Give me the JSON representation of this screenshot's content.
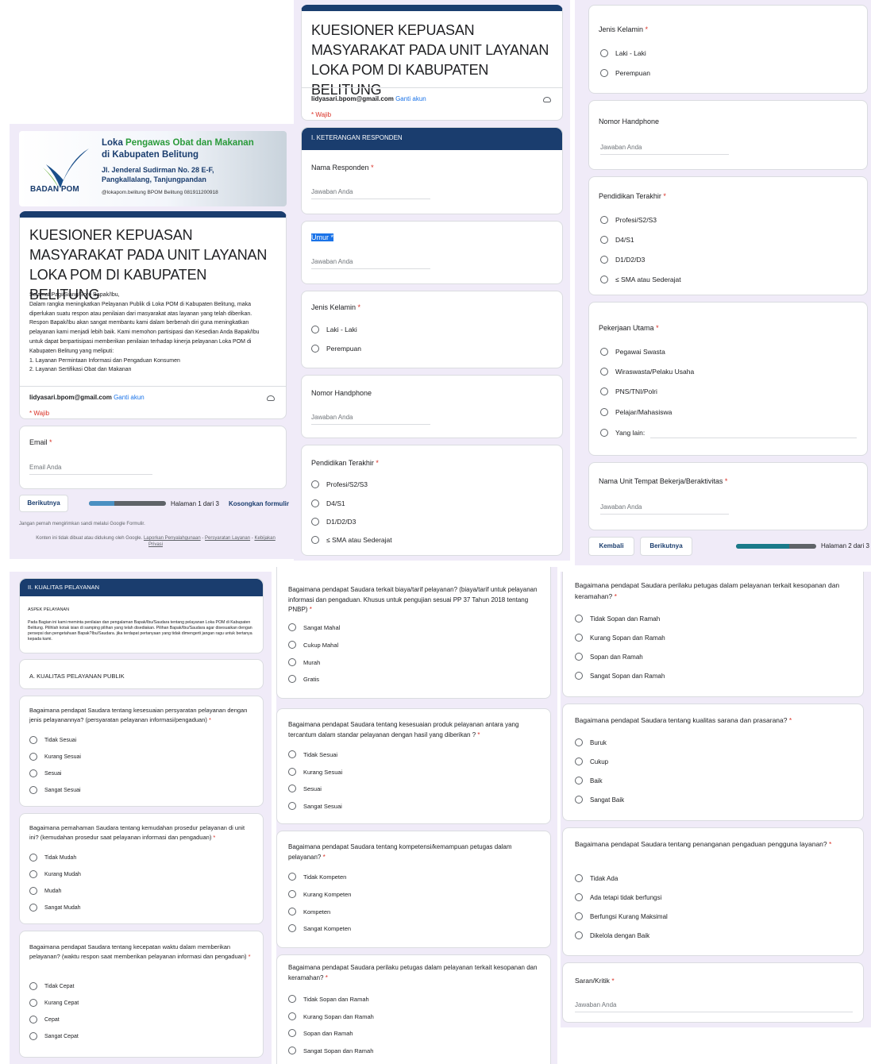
{
  "form": {
    "title": "KUESIONER KEPUASAN MASYARAKAT PADA UNIT LAYANAN LOKA POM DI KABUPATEN BELITUNG",
    "account": "lidyasari.bpom@gmail.com",
    "switch_account": "Ganti akun",
    "required_note": "* Wajib",
    "description": [
      "Selamat Pagi/Siang/Sore Bapak/Ibu,",
      "Dalam rangka meningkatkan Pelayanan Publik di Loka POM di Kabupaten Belitung, maka diperlukan suatu respon atau penilaian dari masyarakat atas layanan yang telah diberikan. Respon Bapak/Ibu akan sangat membantu kami dalam berbenah diri guna meningkatkan pelayanan kami menjadi lebih baik. Kami memohon partisipasi dan Kesedian Anda Bapak/Ibu untuk dapat berpartisipasi memberikan penilaian terhadap kinerja pelayanan Loka POM di Kabupaten Belitung yang meliputi:",
      "1. Layanan Permintaan Informasi dan Pengaduan Konsumen",
      "2. Layanan Sertifikasi Obat dan Makanan"
    ],
    "answer_placeholder": "Jawaban Anda",
    "asterisk": "*"
  },
  "banner": {
    "line1a": "Loka ",
    "line1b": "Pengawas Obat dan Makanan",
    "line2": "di Kabupaten Belitung",
    "addr1": "Jl. Jenderal Sudirman No. 28 E-F,",
    "addr2": "Pangkallalang, Tanjungpandan",
    "social": "@lokapom.belitung  BPOM Belitung  081911200918",
    "logo_text": "BADAN POM"
  },
  "panel1": {
    "email_label": "Email",
    "email_placeholder": "Email Anda",
    "next": "Berikutnya",
    "page": "Halaman 1 dari 3",
    "clear": "Kosongkan formulir",
    "progress": 0.33,
    "footer1": "Jangan pernah mengirimkan sandi melalui Google Formulir.",
    "footer2a": "Konten ini tidak dibuat atau didukung oleh Google. ",
    "footer2b": "Laporkan Penyalahgunaan",
    "footer2c": " - ",
    "footer2d": "Persyaratan Layanan",
    "footer2e": " - ",
    "footer2f": "Kebijakan Privasi"
  },
  "panel2": {
    "section": "I. KETERANGAN RESPONDEN",
    "name": "Nama Responden",
    "age": "Umur",
    "gender": "Jenis Kelamin",
    "gender_opts": [
      "Laki - Laki",
      "Perempuan"
    ],
    "phone": "Nomor Handphone",
    "edu": "Pendidikan Terakhir",
    "edu_opts": [
      "Profesi/S2/S3",
      "D4/S1",
      "D1/D2/D3",
      "≤ SMA atau Sederajat"
    ]
  },
  "panel3": {
    "gender": "Jenis Kelamin",
    "gender_opts": [
      "Laki - Laki",
      "Perempuan"
    ],
    "phone": "Nomor Handphone",
    "edu": "Pendidikan Terakhir",
    "edu_opts": [
      "Profesi/S2/S3",
      "D4/S1",
      "D1/D2/D3",
      "≤ SMA atau Sederajat"
    ],
    "job": "Pekerjaan Utama",
    "job_opts": [
      "Pegawai Swasta",
      "Wiraswasta/Pelaku Usaha",
      "PNS/TNI/Polri",
      "Pelajar/Mahasiswa",
      "Yang lain:"
    ],
    "unit": "Nama Unit Tempat Bekerja/Beraktivitas",
    "back": "Kembali",
    "next": "Berikutnya",
    "page": "Halaman 2 dari 3",
    "progress": 0.66
  },
  "panel4": {
    "section": "II. KUALITAS PELAYANAN",
    "aspect_title": "ASPEK PELAYANAN",
    "aspect_desc": "Pada Bagian ini kami meminta penilaian dan pengalaman Bapak/Ibu/Saudara tentang pelayanan Loka POM di Kabupaten Belitung. Pilihlah kotak isian di samping pilihan yang telah disediakan. Pilihan Bapak/Ibu/Saudara agar disesuaikan dengan persepsi dan pengetahuan Bapak?Ibu/Saudara. jika terdapat pertanyaan yang tidak dimengerti jangan ragu untuk bertanya kepada kami.",
    "subsection": "A. KUALITAS PELAYANAN PUBLIK",
    "q1": "Bagaimana pendapat Saudara tentang kesesuaian persyaratan pelayanan dengan jenis pelayanannya? (persyaratan pelayanan informasi/pengaduan)",
    "q1_opts": [
      "Tidak Sesuai",
      "Kurang Sesuai",
      "Sesuai",
      "Sangat Sesuai"
    ],
    "q2": "Bagaimana pemahaman Saudara tentang kemudahan prosedur pelayanan di unit ini? (kemudahan prosedur saat pelayanan informasi dan pengaduan)",
    "q2_opts": [
      "Tidak Mudah",
      "Kurang Mudah",
      "Mudah",
      "Sangat Mudah"
    ],
    "q3": "Bagaimana pendapat Saudara tentang kecepatan waktu dalam memberikan pelayanan? (waktu respon saat memberikan pelayanan informasi dan pengaduan)",
    "q3_opts": [
      "Tidak Cepat",
      "Kurang Cepat",
      "Cepat",
      "Sangat Cepat"
    ]
  },
  "panel5": {
    "q1": "Bagaimana pendapat Saudara terkait biaya/tarif pelayanan? (biaya/tarif untuk pelayanan informasi dan pengaduan. Khusus untuk pengujian sesuai PP 37 Tahun 2018 tentang PNBP)",
    "q1_opts": [
      "Sangat Mahal",
      "Cukup Mahal",
      "Murah",
      "Gratis"
    ],
    "q2": "Bagaimana pendapat Saudara tentang kesesuaian produk pelayanan antara yang tercantum dalam standar pelayanan dengan hasil yang diberikan ?",
    "q2_opts": [
      "Tidak Sesuai",
      "Kurang Sesuai",
      "Sesuai",
      "Sangat Sesuai"
    ],
    "q3": "Bagaimana pendapat Saudara tentang kompetensi/kemampuan petugas dalam pelayanan?",
    "q3_opts": [
      "Tidak Kompeten",
      "Kurang Kompeten",
      "Kompeten",
      "Sangat Kompeten"
    ],
    "q4": "Bagaimana pendapat Saudara perilaku petugas dalam pelayanan terkait kesopanan dan keramahan?",
    "q4_opts": [
      "Tidak Sopan dan Ramah",
      "Kurang Sopan dan Ramah",
      "Sopan dan Ramah",
      "Sangat Sopan dan Ramah"
    ]
  },
  "panel6": {
    "q1": "Bagaimana pendapat Saudara perilaku petugas dalam pelayanan terkait kesopanan dan keramahan?",
    "q1_opts": [
      "Tidak Sopan dan Ramah",
      "Kurang Sopan dan Ramah",
      "Sopan dan Ramah",
      "Sangat Sopan dan Ramah"
    ],
    "q2": "Bagaimana pendapat Saudara tentang kualitas sarana dan prasarana?",
    "q2_opts": [
      "Buruk",
      "Cukup",
      "Baik",
      "Sangat Baik"
    ],
    "q3": "Bagaimana pendapat Saudara tentang penanganan pengaduan pengguna layanan?",
    "q3_opts": [
      "Tidak Ada",
      "Ada tetapi tidak berfungsi",
      "Berfungsi Kurang Maksimal",
      "Dikelola dengan Baik"
    ],
    "q4": "Saran/Kritik"
  },
  "colors": {
    "header": "#1a3d6e",
    "background": "#f0ebf8",
    "required": "#d93025",
    "link": "#1a73e8"
  }
}
